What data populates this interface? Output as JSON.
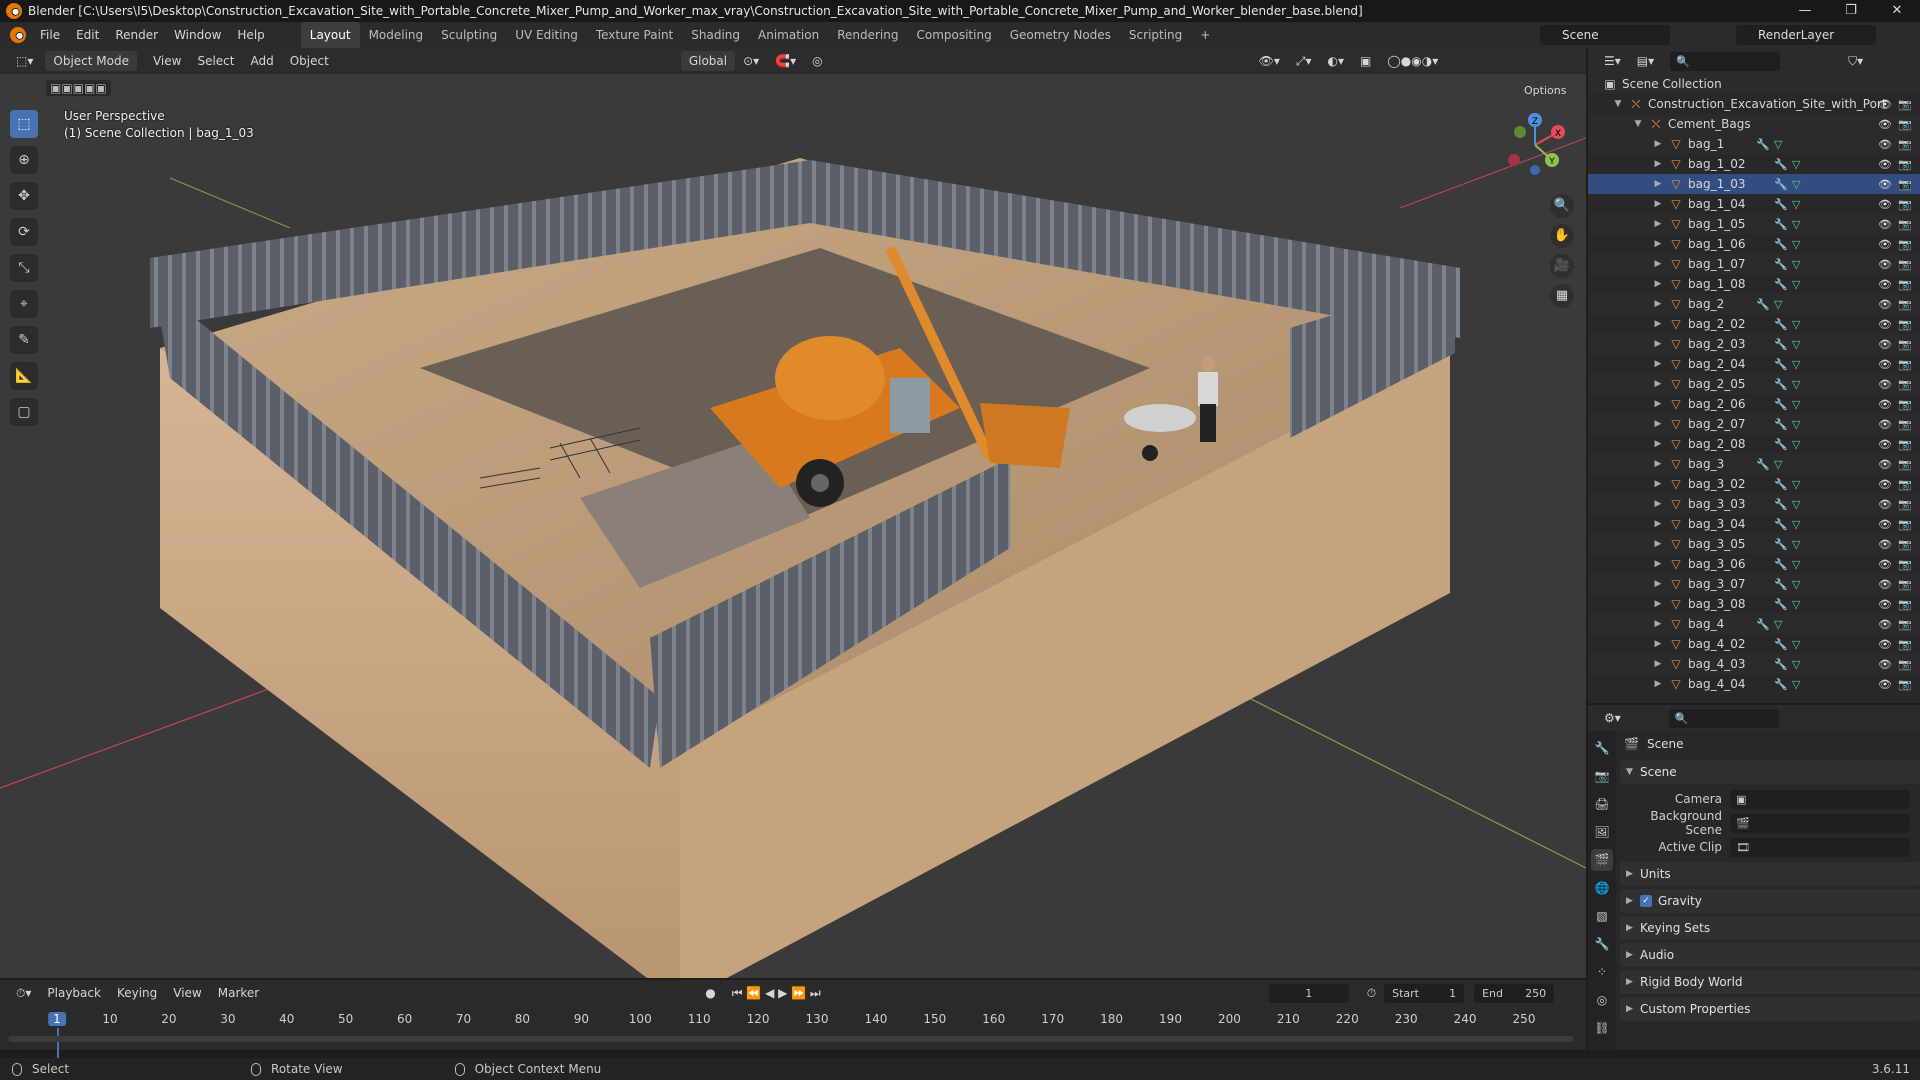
{
  "window": {
    "title": "Blender [C:\\Users\\I5\\Desktop\\Construction_Excavation_Site_with_Portable_Concrete_Mixer_Pump_and_Worker_max_vray\\Construction_Excavation_Site_with_Portable_Concrete_Mixer_Pump_and_Worker_blender_base.blend]",
    "controls": [
      "—",
      "❐",
      "✕"
    ]
  },
  "menu": [
    "File",
    "Edit",
    "Render",
    "Window",
    "Help"
  ],
  "workspaces": [
    {
      "label": "Layout",
      "active": true
    },
    {
      "label": "Modeling"
    },
    {
      "label": "Sculpting"
    },
    {
      "label": "UV Editing"
    },
    {
      "label": "Texture Paint"
    },
    {
      "label": "Shading"
    },
    {
      "label": "Animation"
    },
    {
      "label": "Rendering"
    },
    {
      "label": "Compositing"
    },
    {
      "label": "Geometry Nodes"
    },
    {
      "label": "Scripting"
    }
  ],
  "add_workspace": "+",
  "scene_selector": {
    "scene": "Scene",
    "view_layer": "RenderLayer"
  },
  "viewport": {
    "mode": "Object Mode",
    "menus": [
      "View",
      "Select",
      "Add",
      "Object"
    ],
    "transform_orientation": "Global",
    "options_label": "Options",
    "overlay_title": "User Perspective",
    "overlay_subtitle": "(1) Scene Collection | bag_1_03",
    "gizmo": {
      "x": "X",
      "y": "Y",
      "z": "Z"
    }
  },
  "outliner": {
    "root": "Scene Collection",
    "collection": "Construction_Excavation_Site_with_Port",
    "subcollection": "Cement_Bags",
    "items": [
      "bag_1",
      "bag_1_02",
      "bag_1_03",
      "bag_1_04",
      "bag_1_05",
      "bag_1_06",
      "bag_1_07",
      "bag_1_08",
      "bag_2",
      "bag_2_02",
      "bag_2_03",
      "bag_2_04",
      "bag_2_05",
      "bag_2_06",
      "bag_2_07",
      "bag_2_08",
      "bag_3",
      "bag_3_02",
      "bag_3_03",
      "bag_3_04",
      "bag_3_05",
      "bag_3_06",
      "bag_3_07",
      "bag_3_08",
      "bag_4",
      "bag_4_02",
      "bag_4_03",
      "bag_4_04"
    ]
  },
  "properties": {
    "context_title": "Scene",
    "panel_scene": "Scene",
    "camera_label": "Camera",
    "background_scene_label": "Background Scene",
    "active_clip_label": "Active Clip",
    "panels": [
      "Units",
      "Gravity",
      "Keying Sets",
      "Audio",
      "Rigid Body World",
      "Custom Properties"
    ]
  },
  "timeline": {
    "menus": [
      "Playback",
      "Keying",
      "View",
      "Marker"
    ],
    "current_frame": "1",
    "start_label": "Start",
    "start": "1",
    "end_label": "End",
    "end": "250",
    "ticks": [
      1,
      10,
      20,
      30,
      40,
      50,
      60,
      70,
      80,
      90,
      100,
      110,
      120,
      130,
      140,
      150,
      160,
      170,
      180,
      190,
      200,
      210,
      220,
      230,
      240,
      250
    ]
  },
  "status": {
    "select": "Select",
    "rotate": "Rotate View",
    "context": "Object Context Menu",
    "version": "3.6.11"
  },
  "colors": {
    "accent": "#4772b3",
    "object_orange": "#e8893b",
    "axis_x": "#e34a5a",
    "axis_y": "#8bc34a",
    "axis_z": "#4f8fe0"
  }
}
